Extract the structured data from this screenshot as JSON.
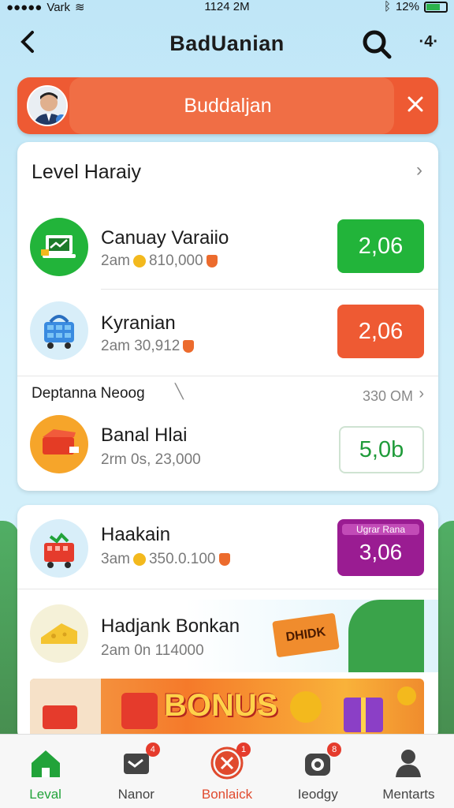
{
  "status": {
    "carrier": "Vark",
    "time": "1124 2M",
    "battery": "12%"
  },
  "header": {
    "title": "BadUanian"
  },
  "banner": {
    "label": "Buddaljan"
  },
  "section1": {
    "title": "Level Haraiy",
    "rows": [
      {
        "name": "Canuay Varaiio",
        "sub": "2am",
        "amount": "810,000",
        "button": "2,06",
        "color": "#22b43a",
        "icon": "laptop-chart-icon"
      },
      {
        "name": "Kyranian",
        "sub": "2am 30,912",
        "amount": "",
        "button": "2,06",
        "color": "#ee5a33",
        "icon": "shopping-cart-icon"
      }
    ],
    "subhead": "Deptanna Neoog",
    "subhead_right": "330 OM",
    "row3": {
      "name": "Banal Hlai",
      "sub": "2rm 0s, 23,000",
      "button": "5,0b",
      "icon": "gift-box-icon"
    }
  },
  "section2": {
    "rows": [
      {
        "name": "Haakain",
        "sub": "3am",
        "amount": "350.0.100",
        "button_top": "Ugrar Rana",
        "button": "3,06",
        "color": "#9a1c92",
        "icon": "gift-cart-icon"
      },
      {
        "name": "Hadjank Bonkan",
        "sub": "2am 0n 114000",
        "icon": "cheese-icon",
        "sticker": "DHIDK"
      }
    ],
    "bonus_text": "BONUS"
  },
  "tabs": [
    {
      "label": "Leval",
      "icon": "home-icon",
      "color": "#22a33a",
      "badge": ""
    },
    {
      "label": "Nanor",
      "icon": "wallet-icon",
      "color": "#444444",
      "badge": "4"
    },
    {
      "label": "Bonlaick",
      "icon": "close-circle-icon",
      "color": "#e04a2e",
      "badge": "1"
    },
    {
      "label": "Ieodgy",
      "icon": "camera-icon",
      "color": "#444444",
      "badge": "8"
    },
    {
      "label": "Mentarts",
      "icon": "person-icon",
      "color": "#444444",
      "badge": ""
    }
  ]
}
